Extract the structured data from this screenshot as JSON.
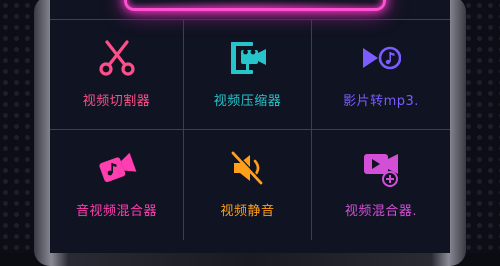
{
  "colors": {
    "cutter": "#ff4f8a",
    "compressor": "#27c4c9",
    "to_mp3": "#7b5cff",
    "audio_mixer": "#ff3fb0",
    "mute": "#ff9f1a",
    "video_mixer": "#d44fd8",
    "neon": "#ff4fd2"
  },
  "tiles": [
    {
      "label": "视频切割器",
      "icon": "scissors-icon",
      "color": "#ff4f8a"
    },
    {
      "label": "视频压缩器",
      "icon": "clamp-camera-icon",
      "color": "#27c4c9"
    },
    {
      "label": "影片转mp3.",
      "icon": "play-music-note-icon",
      "color": "#7b5cff"
    },
    {
      "label": "音视频混合器",
      "icon": "music-camera-icon",
      "color": "#ff3fb0"
    },
    {
      "label": "视频静音",
      "icon": "mute-speaker-icon",
      "color": "#ff9f1a"
    },
    {
      "label": "视频混合器.",
      "icon": "video-add-icon",
      "color": "#d44fd8"
    }
  ]
}
